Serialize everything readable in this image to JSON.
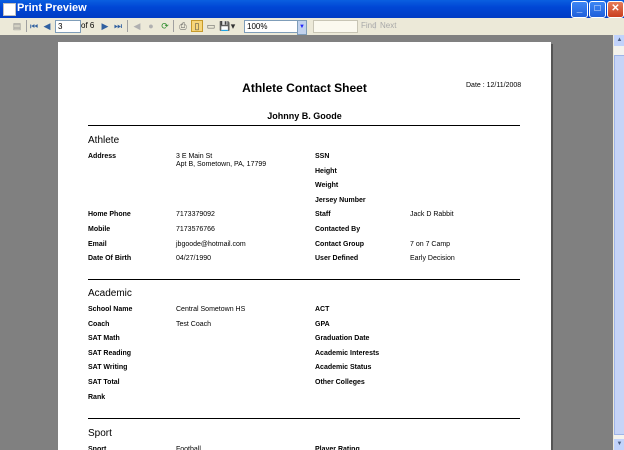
{
  "window": {
    "title": "Print Preview"
  },
  "toolbar": {
    "page_current": "3",
    "page_of": "of 6",
    "zoom": "100%",
    "find_label": "Find",
    "next_label": "Next"
  },
  "report": {
    "title": "Athlete Contact Sheet",
    "date": "Date : 12/11/2008",
    "athlete_name": "Johnny B. Goode",
    "sections": {
      "athlete": "Athlete",
      "academic": "Academic",
      "sport": "Sport"
    },
    "athlete": {
      "left": [
        {
          "label": "Address",
          "value": "3 E Main St",
          "value2": "Apt B, Sometown, PA, 17799"
        },
        {
          "label": "Home Phone",
          "value": "7173379092"
        },
        {
          "label": "Mobile",
          "value": "7173576766"
        },
        {
          "label": "Email",
          "value": "jbgoode@hotmail.com"
        },
        {
          "label": "Date Of Birth",
          "value": "04/27/1990"
        }
      ],
      "right": [
        {
          "label": "SSN",
          "value": ""
        },
        {
          "label": "Height",
          "value": ""
        },
        {
          "label": "Weight",
          "value": ""
        },
        {
          "label": "Jersey Number",
          "value": ""
        },
        {
          "label": "Staff",
          "value": "Jack D Rabbit"
        },
        {
          "label": "Contacted By",
          "value": ""
        },
        {
          "label": "Contact Group",
          "value": "7 on 7 Camp"
        },
        {
          "label": "User Defined",
          "value": "Early Decision"
        }
      ]
    },
    "academic": {
      "left": [
        {
          "label": "School Name",
          "value": "Central Sometown HS"
        },
        {
          "label": "Coach",
          "value": "Test Coach"
        },
        {
          "label": "SAT Math",
          "value": ""
        },
        {
          "label": "SAT Reading",
          "value": ""
        },
        {
          "label": "SAT Writing",
          "value": ""
        },
        {
          "label": "SAT Total",
          "value": ""
        },
        {
          "label": "Rank",
          "value": ""
        }
      ],
      "right": [
        {
          "label": "ACT",
          "value": ""
        },
        {
          "label": "GPA",
          "value": ""
        },
        {
          "label": "Graduation Date",
          "value": ""
        },
        {
          "label": "Academic Interests",
          "value": ""
        },
        {
          "label": "Academic Status",
          "value": ""
        },
        {
          "label": "Other Colleges",
          "value": ""
        }
      ]
    },
    "sport": {
      "left": [
        {
          "label": "Sport",
          "value": "Football"
        }
      ],
      "right": [
        {
          "label": "Player Rating",
          "value": ""
        }
      ]
    }
  }
}
